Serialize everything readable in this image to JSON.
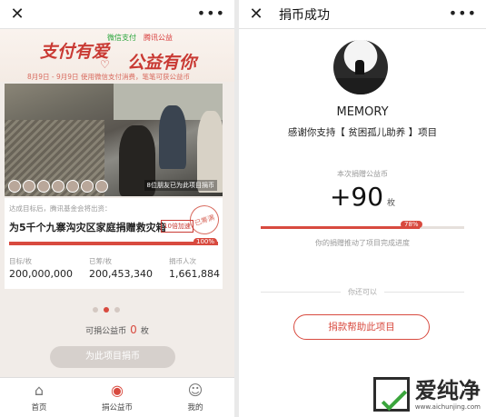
{
  "left": {
    "nav": {
      "close": "✕",
      "more": "•••"
    },
    "banner": {
      "wechat_pay": "微信支付",
      "tencent_charity": "腾讯公益",
      "title_left": "支付有爱",
      "title_right": "公益有你",
      "subtitle": "8月9日 - 9月9日 使用微信支付消费，笔笔可获公益币"
    },
    "photo_caption": "8位朋友已为此项目捐币",
    "project": {
      "note": "达成目标后，腾讯基金会将出资：",
      "name": "为5千个九寨沟灾区家庭捐赠救灾箱",
      "tag": "10倍加速",
      "stamp": "已筹满",
      "progress_label": "100%",
      "progress": 1.0,
      "stats": [
        {
          "label": "目标/枚",
          "value": "200,000,000"
        },
        {
          "label": "已筹/枚",
          "value": "200,453,340"
        },
        {
          "label": "捐币人次",
          "value": "1,661,884"
        }
      ]
    },
    "coins": {
      "prefix": "可捐公益币",
      "value": "0",
      "unit": "枚"
    },
    "donate_button": "为此项目捐币",
    "tabs": [
      {
        "label": "首页",
        "icon": "home-icon"
      },
      {
        "label": "捐公益币",
        "icon": "coin-icon"
      },
      {
        "label": "我的",
        "icon": "user-icon"
      }
    ]
  },
  "right": {
    "nav": {
      "close": "✕",
      "title": "捐币成功",
      "more": "•••"
    },
    "username": "MEMORY",
    "thanks": "感谢你支持【 贫困孤儿助养 】项目",
    "amount_label": "本次捐赠公益币",
    "amount": "+90",
    "amount_unit": "枚",
    "progress_label": "78%",
    "progress": 0.78,
    "progress_text": "你的捐赠推动了项目完成进度",
    "divider_text": "你还可以",
    "help_button": "捐款帮助此项目"
  },
  "watermark": {
    "text": "爱纯净",
    "url": "www.aichunjing.com"
  },
  "colors": {
    "accent": "#d84a3f"
  }
}
